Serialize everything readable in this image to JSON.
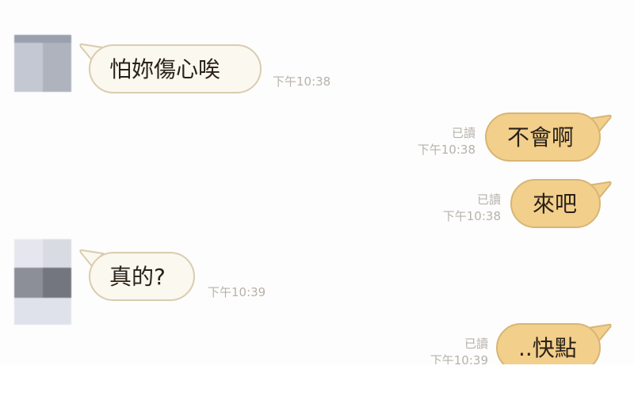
{
  "chat": {
    "messages": [
      {
        "side": "in",
        "text": "怕妳傷心唉",
        "time": "下午10:38",
        "read": ""
      },
      {
        "side": "out",
        "text": "不會啊",
        "time": "下午10:38",
        "read": "已讀"
      },
      {
        "side": "out",
        "text": "來吧",
        "time": "下午10:38",
        "read": "已讀"
      },
      {
        "side": "in",
        "text": "真的?",
        "time": "下午10:39",
        "read": ""
      },
      {
        "side": "out",
        "text": "..快點",
        "time": "下午10:39",
        "read": "已讀"
      }
    ]
  },
  "colors": {
    "incoming_bubble": "#fbf8ef",
    "incoming_border": "#d9ccb0",
    "outgoing_bubble": "#f3cf8c",
    "outgoing_border": "#d8b575",
    "meta_text": "#b7b2aa"
  },
  "icons": {
    "avatar": "avatar-icon"
  }
}
